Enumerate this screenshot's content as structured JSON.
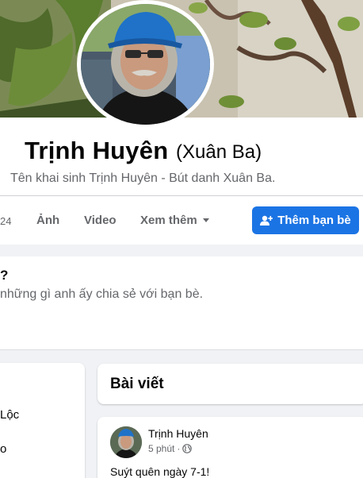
{
  "profile": {
    "name": "Trịnh Huyên",
    "alternate_name": "(Xuân Ba)",
    "bio": "Tên khai sinh Trịnh Huyên - Bút danh Xuân Ba."
  },
  "tabs": {
    "count_fragment": "24",
    "photos": "Ảnh",
    "video": "Video",
    "more": "Xem thêm"
  },
  "actions": {
    "add_friend": "Thêm bạn bè"
  },
  "intro": {
    "question_fragment": "?",
    "text_fragment": "những gì anh ấy chia sẻ với bạn bè."
  },
  "left_column": {
    "item1": "Lộc",
    "item2": "o"
  },
  "posts": {
    "title": "Bài viết",
    "first": {
      "author": "Trịnh Huyên",
      "time": "5 phút",
      "separator": "·",
      "text": "Suýt quên ngày 7-1!"
    }
  },
  "colors": {
    "primary_button": "#1b74e4",
    "secondary_text": "#65676b",
    "page_bg": "#f0f2f5"
  },
  "icons": {
    "add_friend": "person-plus-icon",
    "more": "caret-down-icon",
    "privacy": "globe-icon"
  }
}
